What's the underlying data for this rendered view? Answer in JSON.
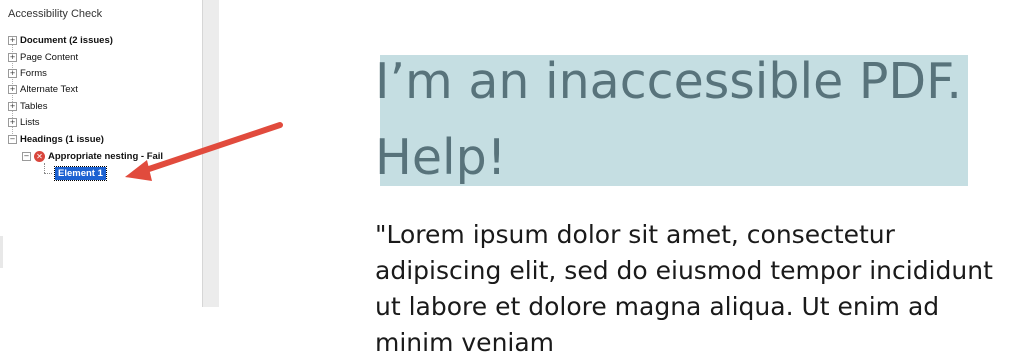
{
  "panel": {
    "title": "Accessibility Check",
    "items": [
      {
        "label": "Document (2 issues)",
        "bold": true
      },
      {
        "label": "Page Content",
        "bold": false
      },
      {
        "label": "Forms",
        "bold": false
      },
      {
        "label": "Alternate Text",
        "bold": false
      },
      {
        "label": "Tables",
        "bold": false
      },
      {
        "label": "Lists",
        "bold": false
      },
      {
        "label": "Headings (1 issue)",
        "bold": true
      }
    ],
    "child": {
      "label": "Appropriate nesting - Fail",
      "icon": "fail-icon"
    },
    "selected": {
      "label": "Element 1"
    }
  },
  "document": {
    "heading": "I’m an inaccessible PDF. Help!",
    "body": "\"Lorem ipsum dolor sit amet, consectetur adipiscing elit, sed do eiusmod tempor incididunt ut labore et dolore magna aliqua. Ut enim ad minim veniam"
  },
  "colors": {
    "highlight": "#c5dee2",
    "heading": "#58737b",
    "arrow": "#e14b3d",
    "selection": "#1c62d2",
    "fail": "#d9463c"
  }
}
